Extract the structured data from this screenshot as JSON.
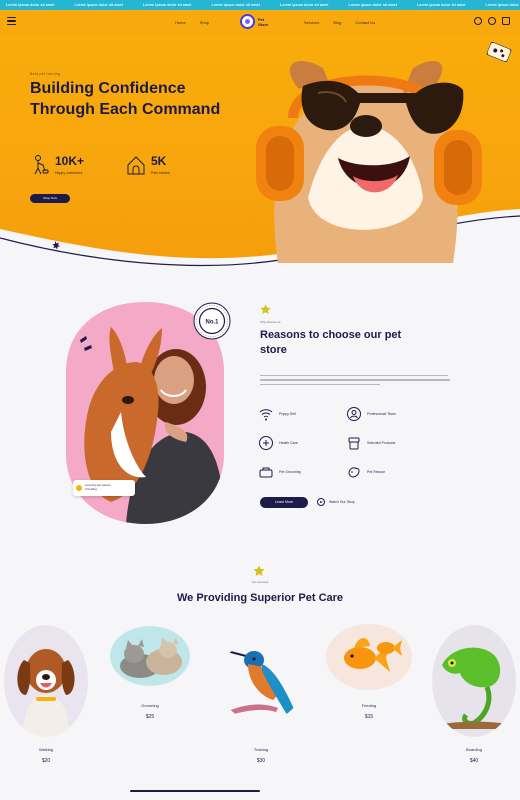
{
  "ticker": {
    "items": [
      "Lorem ipsum dolor sit amet",
      "Lorem ipsum dolor sit amet",
      "Lorem ipsum dolor sit amet",
      "Lorem ipsum dolor sit amet",
      "Lorem ipsum dolor sit amet",
      "Lorem ipsum dolor sit amet",
      "Lorem ipsum dolor sit amet",
      "Lorem ipsum dolor sit amet",
      "Lorem ipsum dolor sit amet"
    ]
  },
  "header": {
    "nav_left": [
      "Home",
      "Shop"
    ],
    "nav_right": [
      "Services",
      "Blog",
      "Contact Us"
    ],
    "logo_text": "Pet Store",
    "icons": [
      "search-icon",
      "user-icon",
      "cart-icon"
    ]
  },
  "hero": {
    "tag": "Best pet training",
    "title": "Building Confidence Through Each Command",
    "stats": [
      {
        "value": "10K+",
        "label": "Happy customers",
        "icon": "dog-walker-icon"
      },
      {
        "value": "5K",
        "label": "Pets trained",
        "icon": "dog-house-icon"
      }
    ],
    "button": "Shop Now"
  },
  "reasons": {
    "badge": "No.1",
    "review": {
      "line1": "Loved by pet owners",
      "line2": "4.9 rating"
    },
    "kicker": "Why choose us",
    "title": "Reasons to choose our pet store",
    "features": [
      {
        "label": "Puppy Sell",
        "icon": "wifi-pet-icon"
      },
      {
        "label": "Professional Team",
        "icon": "team-icon"
      },
      {
        "label": "Health Care",
        "icon": "health-icon"
      },
      {
        "label": "Selected Products",
        "icon": "products-icon"
      },
      {
        "label": "Pet Grooming",
        "icon": "grooming-icon"
      },
      {
        "label": "Pet Rescue",
        "icon": "rescue-icon"
      }
    ],
    "button": "Learn More",
    "play_label": "Watch Our Story"
  },
  "services": {
    "kicker": "Our services",
    "title": "We Providing Superior Pet Care",
    "pets": [
      {
        "name": "Walking",
        "price": "$20"
      },
      {
        "name": "Grooming",
        "price": "$25"
      },
      {
        "name": "Training",
        "price": "$30"
      },
      {
        "name": "Feeding",
        "price": "$15"
      },
      {
        "name": "Boarding",
        "price": "$40"
      }
    ]
  },
  "colors": {
    "accent": "#f7a90e",
    "primary": "#1e1b4b",
    "ticker": "#24b6d3",
    "background": "#f6f5f8"
  }
}
